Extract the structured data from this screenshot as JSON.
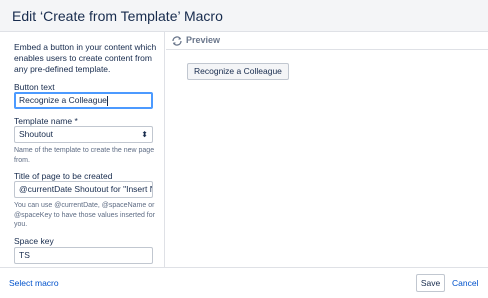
{
  "dialog": {
    "title": "Edit ‘Create from Template’ Macro"
  },
  "form": {
    "description": "Embed a button in your content which enables users to create content from any pre-defined template.",
    "button_text": {
      "label": "Button text",
      "value": "Recognize a Colleague"
    },
    "template_name": {
      "label": "Template name *",
      "value": "Shoutout",
      "help": "Name of the template to create the new page from."
    },
    "title_of_page": {
      "label": "Title of page to be created",
      "value": "@currentDate Shoutout for \"Insert N",
      "help": "You can use @currentDate, @spaceName or @spaceKey to have those values inserted for you."
    },
    "space_key": {
      "label": "Space key",
      "value": "TS"
    }
  },
  "preview": {
    "label": "Preview",
    "button_label": "Recognize a Colleague"
  },
  "footer": {
    "select_macro": "Select macro",
    "save": "Save",
    "cancel": "Cancel"
  },
  "colors": {
    "link": "#0052cc",
    "focus_border": "#4c9aff",
    "text": "#172b4d"
  },
  "icons": {
    "preview_refresh": "refresh-icon",
    "select_arrow": "up-down-arrows-icon"
  }
}
